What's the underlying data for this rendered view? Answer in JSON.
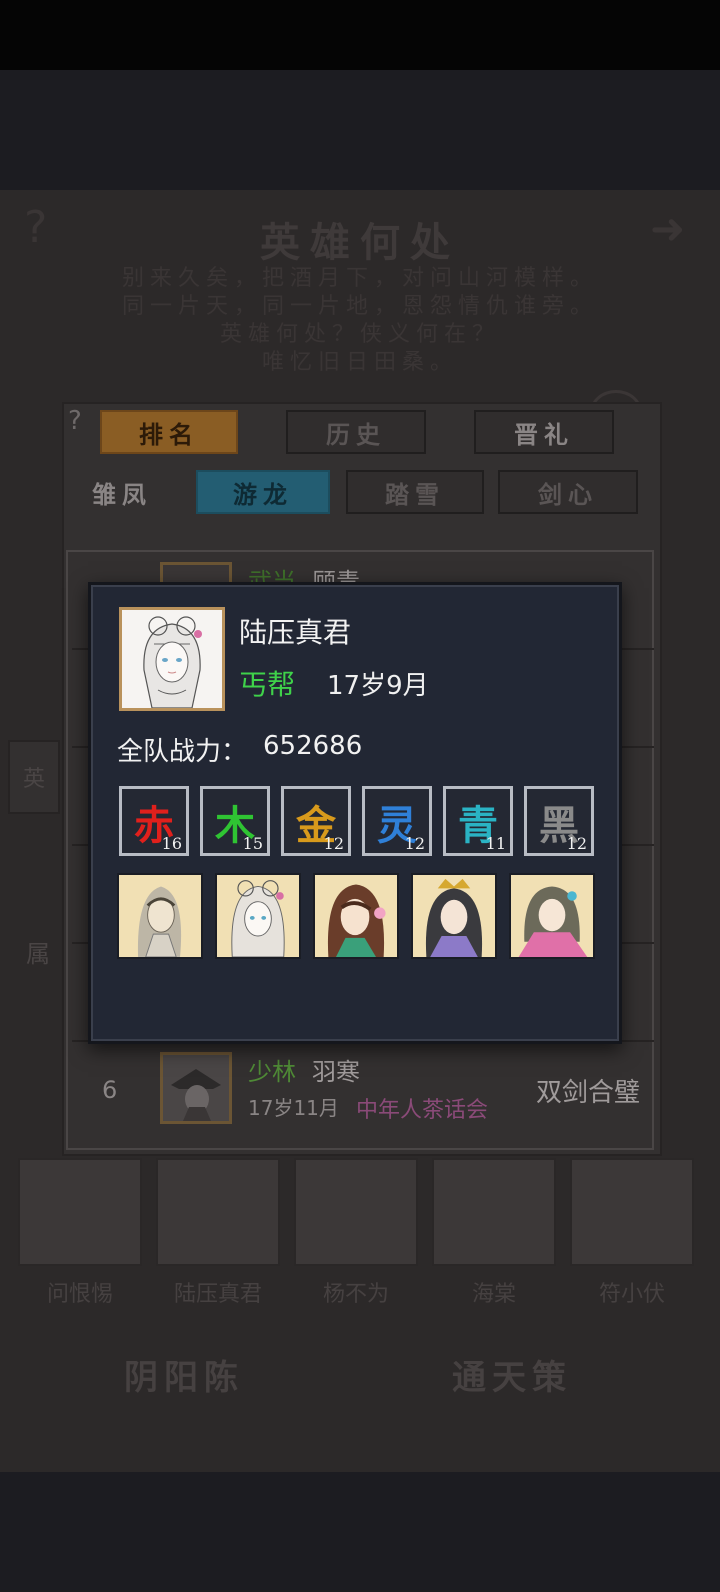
{
  "background": {
    "title": "英雄何处",
    "poem": [
      "别来久矣，把酒月下，对问山河模样。",
      "同一片天，同一片地，恩怨情仇谁旁。",
      "英雄何处？侠义何在？",
      "唯忆旧日田桑。"
    ],
    "tabs_top": [
      "排名",
      "历史",
      "晋礼"
    ],
    "tabs_sub": [
      "雏凤",
      "游龙",
      "踏雪",
      "剑心"
    ],
    "side_left": "英",
    "side_left2": "属",
    "ranking_rows": [
      {
        "rank": "",
        "sect": "武当",
        "name": "顾青",
        "age": "",
        "guild": "",
        "title": ""
      },
      {
        "rank": "6",
        "sect": "少林",
        "name": "羽寒",
        "age": "17岁11月",
        "guild": "中年人茶话会",
        "title": "双剑合璧"
      }
    ],
    "portraits": [
      "问恨惕",
      "陆压真君",
      "杨不为",
      "海棠",
      "符小伏"
    ],
    "buttons": [
      "阴阳陈",
      "通天策"
    ],
    "help_icon": "question-icon",
    "next_icon": "arrow-right-icon"
  },
  "modal": {
    "name": "陆压真君",
    "sect": "丐帮",
    "age": "17岁9月",
    "power_label": "全队战力：",
    "power_value": "652686",
    "elements": [
      {
        "char": "赤",
        "level": "16",
        "color": "#e0201c"
      },
      {
        "char": "木",
        "level": "15",
        "color": "#2fc433"
      },
      {
        "char": "金",
        "level": "12",
        "color": "#d89a1c"
      },
      {
        "char": "灵",
        "level": "12",
        "color": "#2f80d8"
      },
      {
        "char": "青",
        "level": "11",
        "color": "#2ab3c4"
      },
      {
        "char": "黑",
        "level": "12",
        "color": "#8a8a8a"
      }
    ],
    "team_icons": [
      "swordsman-portrait",
      "braided-girl-portrait",
      "flower-girl-portrait",
      "crowned-lady-portrait",
      "pink-girl-portrait"
    ]
  },
  "colors": {
    "accent_green": "#3fd24a",
    "modal_bg": "#222734"
  }
}
